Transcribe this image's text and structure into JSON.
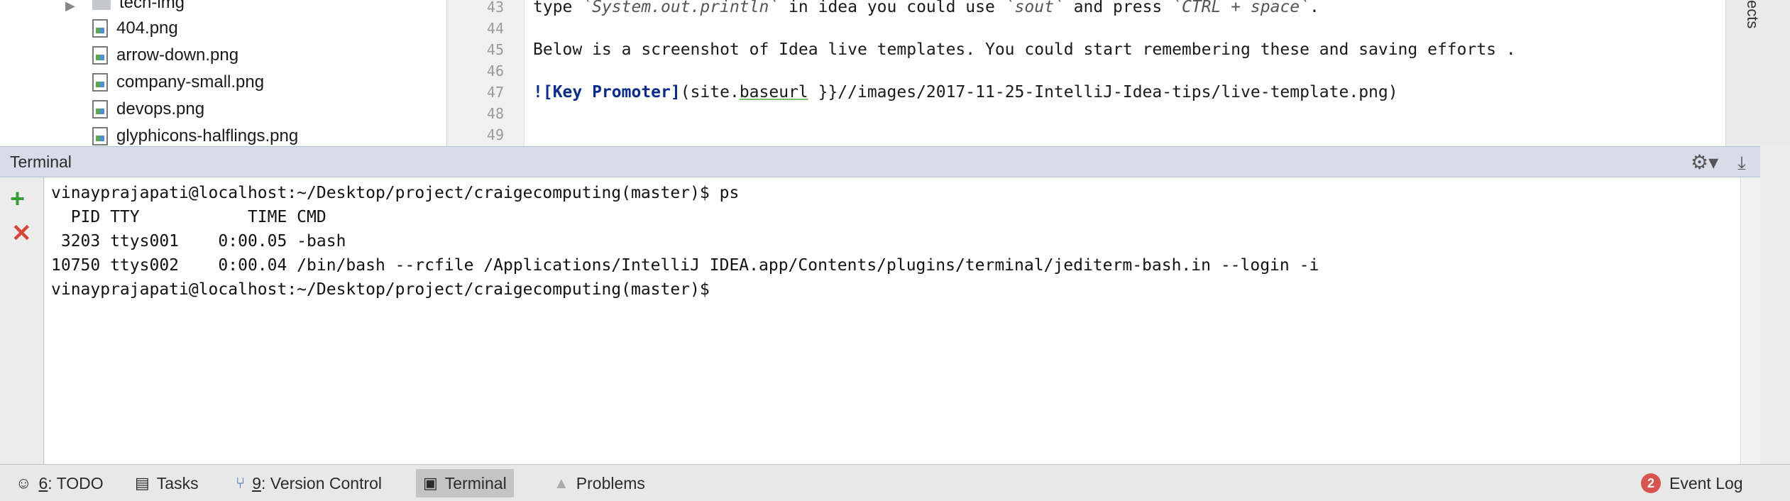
{
  "project_tree": {
    "folder": "tech-img",
    "files": [
      "404.png",
      "arrow-down.png",
      "company-small.png",
      "devops.png",
      "glyphicons-halflings.png"
    ]
  },
  "editor": {
    "line_numbers": [
      "43",
      "44",
      "45",
      "46",
      "47",
      "48",
      "49"
    ],
    "line43": {
      "a": "type ",
      "b": "`System.out.println`",
      "c": " in idea you could use ",
      "d": "`sout`",
      "e": " and press ",
      "f": "`CTRL + space`",
      "g": "."
    },
    "line45": "Below is a screenshot of Idea live templates. You could start remembering these and saving efforts .",
    "line47": {
      "kw": "![Key Promoter]",
      "p1": "(site.",
      "ul": "baseurl",
      "p2": " }}//images/2017-11-25-IntelliJ-Idea-tips/live-template.png)"
    }
  },
  "right_strip_label": "ects",
  "terminal": {
    "title": "Terminal",
    "lines": [
      "vinayprajapati@localhost:~/Desktop/project/craigecomputing(master)$ ps",
      "  PID TTY           TIME CMD",
      " 3203 ttys001    0:00.05 -bash",
      "10750 ttys002    0:00.04 /bin/bash --rcfile /Applications/IntelliJ IDEA.app/Contents/plugins/terminal/jediterm-bash.in --login -i",
      "vinayprajapati@localhost:~/Desktop/project/craigecomputing(master)$"
    ]
  },
  "bottom_bar": {
    "todo": {
      "num": "6",
      "label": ": TODO"
    },
    "tasks": "Tasks",
    "vcs": {
      "num": "9",
      "label": ": Version Control"
    },
    "terminal": "Terminal",
    "problems": "Problems",
    "event_count": "2",
    "event_log": "Event Log"
  },
  "colors": {
    "accent_add": "#3a9b3a",
    "accent_close": "#d64538",
    "header_bg": "#d6dde8",
    "badge": "#d9534f"
  }
}
